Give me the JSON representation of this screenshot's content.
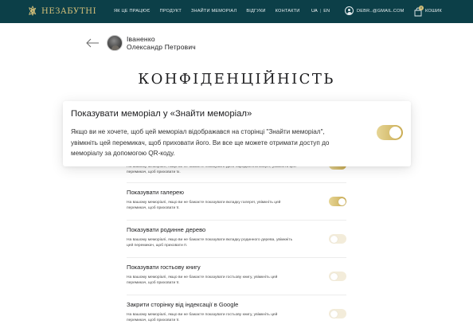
{
  "brand": {
    "name": "НЕЗАБУТНІ"
  },
  "nav": [
    "ЯК ЦЕ ПРАЦЮЄ",
    "ПРОДУКТ",
    "ЗНАЙТИ МЕМОРІАЛ",
    "ВІДГУКИ",
    "КОНТАКТИ"
  ],
  "lang": {
    "ua": "UA",
    "separator": "|",
    "en": "EN",
    "active": "UA"
  },
  "user": {
    "email": "DEBR..@GMAIL.COM"
  },
  "cart": {
    "label": "КОШИК",
    "count": "0"
  },
  "profile": {
    "line1": "Іваненко",
    "line2": "Олександр Петрович"
  },
  "page_title": "КОНФІДЕНЦІЙНІСТЬ",
  "popup": {
    "title": "Показувати меморіал у «Знайти меморіал»",
    "description": "Якщо ви не хочете, щоб цей меморіал відображався на сторінці \"Знайти меморіал\", увімкніть цей перемикач, щоб приховати його. Ви все ще можете отримати доступ до меморіалу за допомогою QR-коду.",
    "enabled": true
  },
  "partial_setting": {
    "description": "На вашому меморіалі, якщо ви не бажаєте показувати дати народження/смерті, увімкніть цей перемикач, щоб приховати їх.",
    "enabled": true
  },
  "settings": [
    {
      "title": "Показувати галерею",
      "description": "На вашому меморіалі, якщо ви не бажаєте показувати вкладку галереї, увімкніть цей перемикач, щоб приховати її.",
      "enabled": true
    },
    {
      "title": "Показувати родинне дерево",
      "description": "На вашому меморіалі, якщо ви не бажаєте показувати вкладку родинного дерева, увімкніть цей перемикач, щоб приховати її.",
      "enabled": false
    },
    {
      "title": "Показувати гостьову книгу",
      "description": "На вашому меморіалі, якщо ви не бажаєте показувати гостьову книгу, увімкніть цей перемикач, щоб приховати її.",
      "enabled": false
    },
    {
      "title": "Закрити сторінку від індексації в Google",
      "description": "На вашому меморіалі, якщо ви не бажаєте показувати гостьову книгу, увімкніть цей перемикач, щоб приховати її.",
      "enabled": false
    }
  ],
  "colors": {
    "header_bg": "#0c3f48",
    "gold": "#d8c27a",
    "toggle_off": "#f3ecda"
  }
}
